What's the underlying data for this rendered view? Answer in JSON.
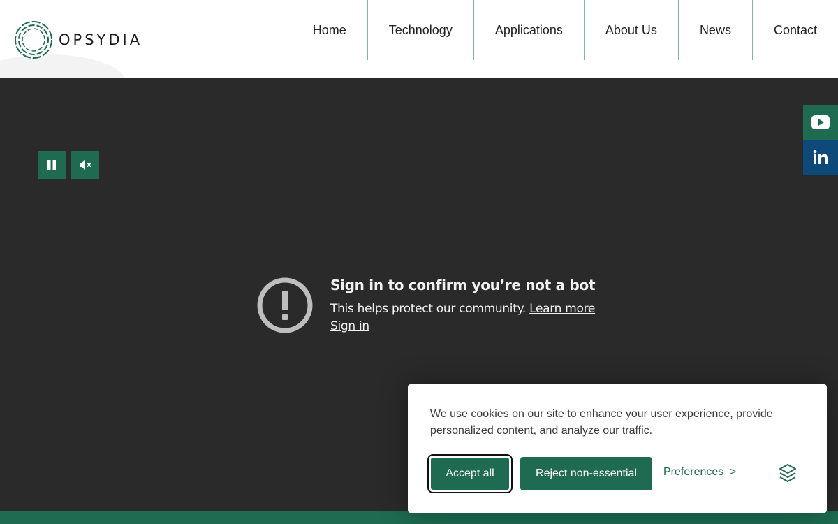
{
  "brand": {
    "name": "OPSYDIA",
    "accent": "#1e6b52",
    "linkedin_color": "#0d4a7a"
  },
  "nav": {
    "items": [
      {
        "label": "Home"
      },
      {
        "label": "Technology"
      },
      {
        "label": "Applications"
      },
      {
        "label": "About Us"
      },
      {
        "label": "News"
      },
      {
        "label": "Contact"
      }
    ]
  },
  "video_controls": {
    "pause_icon": "pause-icon",
    "mute_icon": "volume-mute-icon"
  },
  "social": {
    "youtube_icon": "youtube-icon",
    "linkedin_icon": "linkedin-icon"
  },
  "bot_check": {
    "title": "Sign in to confirm you’re not a bot",
    "description": "This helps protect our community.",
    "learn_more": "Learn more",
    "sign_in": "Sign in"
  },
  "cookie": {
    "message": "We use cookies on our site to enhance your user experience, provide personalized content, and analyze our traffic.",
    "accept_label": "Accept all",
    "reject_label": "Reject non-essential",
    "preferences_label": "Preferences",
    "preferences_arrow": ">"
  }
}
